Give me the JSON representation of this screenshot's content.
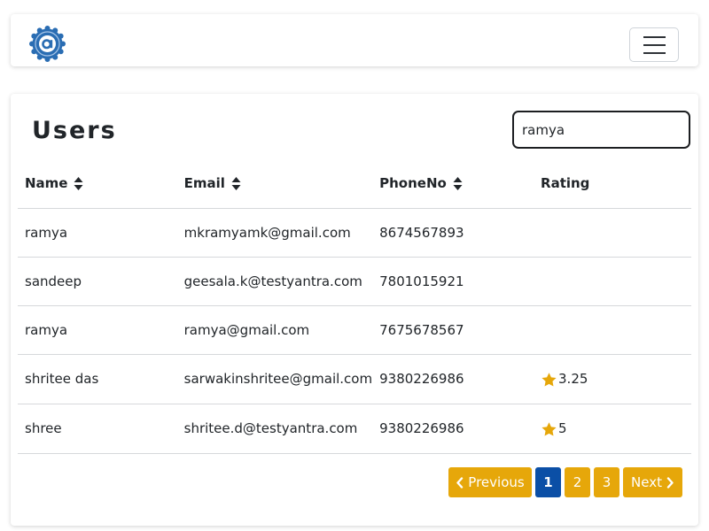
{
  "header": {
    "logo": "app-logo",
    "menu_icon": "hamburger-menu-icon"
  },
  "main": {
    "title": "Users",
    "search": {
      "value": "ramya",
      "placeholder": ""
    },
    "table": {
      "columns": [
        {
          "label": "Name",
          "sortable": true
        },
        {
          "label": "Email",
          "sortable": true
        },
        {
          "label": "PhoneNo",
          "sortable": true
        },
        {
          "label": "Rating",
          "sortable": false
        }
      ],
      "rows": [
        {
          "name": "ramya",
          "email": "mkramyamk@gmail.com",
          "phone": "8674567893",
          "rating": ""
        },
        {
          "name": "sandeep",
          "email": "geesala.k@testyantra.com",
          "phone": "7801015921",
          "rating": ""
        },
        {
          "name": "ramya",
          "email": "ramya@gmail.com",
          "phone": "7675678567",
          "rating": ""
        },
        {
          "name": "shritee das",
          "email": "sarwakinshritee@gmail.com",
          "phone": "9380226986",
          "rating": "3.25"
        },
        {
          "name": "shree",
          "email": "shritee.d@testyantra.com",
          "phone": "9380226986",
          "rating": "5"
        }
      ]
    },
    "pagination": {
      "previous_label": "Previous",
      "next_label": "Next",
      "pages": [
        "1",
        "2",
        "3"
      ],
      "current_page": "1"
    }
  },
  "colors": {
    "accent": "#e6a70a",
    "active_page": "#0b4fa6",
    "logo_blue": "#2a6db3",
    "star": "#e6a70a"
  }
}
